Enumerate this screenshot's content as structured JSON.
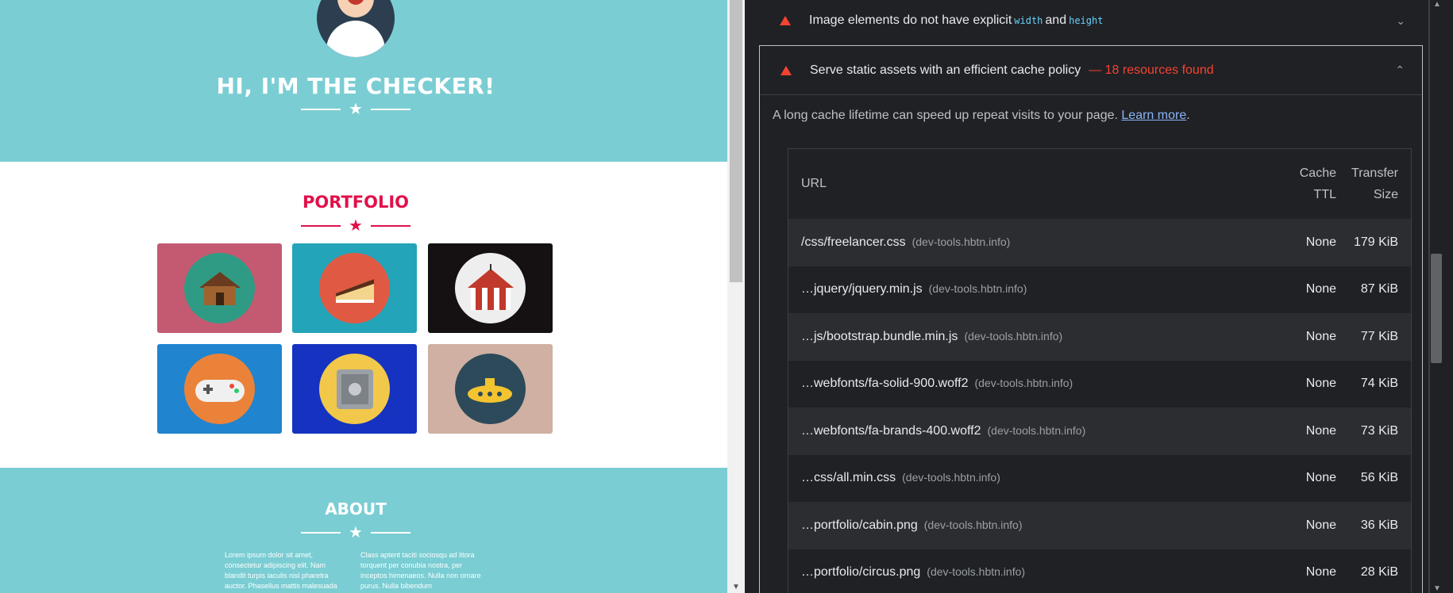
{
  "site": {
    "masthead_title": "HI, I'M THE CHECKER!",
    "portfolio_title": "PORTFOLIO",
    "about_title": "ABOUT",
    "about_col1": "Lorem ipsum dolor sit amet, consectetur adipiscing elit. Nam blandit turpis iaculis nisl pharetra auctor. Phasellus mattis malesuada",
    "about_col2": "Class aptent taciti sociosqu ad litora torquent per conubia nostra, per inceptos himenaeos. Nulla non ornare purus. Nulla bibendum",
    "portfolio_items": [
      {
        "name": "cabin",
        "bg": "#c45a72",
        "disc": "#2f9b84"
      },
      {
        "name": "cake",
        "bg": "#23a4b8",
        "disc": "#e05a43"
      },
      {
        "name": "circus",
        "bg": "#151112",
        "disc": "#eeeeee"
      },
      {
        "name": "game",
        "bg": "#2084cf",
        "disc": "#ea8339"
      },
      {
        "name": "safe",
        "bg": "#1533c0",
        "disc": "#f2c84b"
      },
      {
        "name": "submarine",
        "bg": "#cfb0a2",
        "disc": "#2c4a5a"
      }
    ]
  },
  "audits": {
    "img_dims": {
      "title": "Image elements do not have explicit",
      "code1": "width",
      "and": "and",
      "code2": "height"
    },
    "cache": {
      "title": "Serve static assets with an efficient cache policy",
      "found": "— 18 resources found",
      "description": "A long cache lifetime can speed up repeat visits to your page.",
      "learn_more": "Learn more",
      "period": "."
    }
  },
  "table": {
    "headers": {
      "url": "URL",
      "ttl_1": "Cache",
      "ttl_2": "TTL",
      "size_1": "Transfer",
      "size_2": "Size"
    },
    "rows": [
      {
        "url": "/css/freelancer.css",
        "host": "(dev-tools.hbtn.info)",
        "ttl": "None",
        "size": "179 KiB"
      },
      {
        "url": "…jquery/jquery.min.js",
        "host": "(dev-tools.hbtn.info)",
        "ttl": "None",
        "size": "87 KiB"
      },
      {
        "url": "…js/bootstrap.bundle.min.js",
        "host": "(dev-tools.hbtn.info)",
        "ttl": "None",
        "size": "77 KiB"
      },
      {
        "url": "…webfonts/fa-solid-900.woff2",
        "host": "(dev-tools.hbtn.info)",
        "ttl": "None",
        "size": "74 KiB"
      },
      {
        "url": "…webfonts/fa-brands-400.woff2",
        "host": "(dev-tools.hbtn.info)",
        "ttl": "None",
        "size": "73 KiB"
      },
      {
        "url": "…css/all.min.css",
        "host": "(dev-tools.hbtn.info)",
        "ttl": "None",
        "size": "56 KiB"
      },
      {
        "url": "…portfolio/cabin.png",
        "host": "(dev-tools.hbtn.info)",
        "ttl": "None",
        "size": "36 KiB"
      },
      {
        "url": "…portfolio/circus.png",
        "host": "(dev-tools.hbtn.info)",
        "ttl": "None",
        "size": "28 KiB"
      }
    ]
  },
  "icons": {
    "warning": "warning-triangle-icon",
    "collapse": "chevron-up-icon",
    "expand": "chevron-down-icon"
  },
  "colors": {
    "accent_red": "#e0114a",
    "teal": "#7acdd3",
    "devtools_bg": "#202124",
    "warn_red": "#f54331",
    "link": "#8ab4f8"
  }
}
